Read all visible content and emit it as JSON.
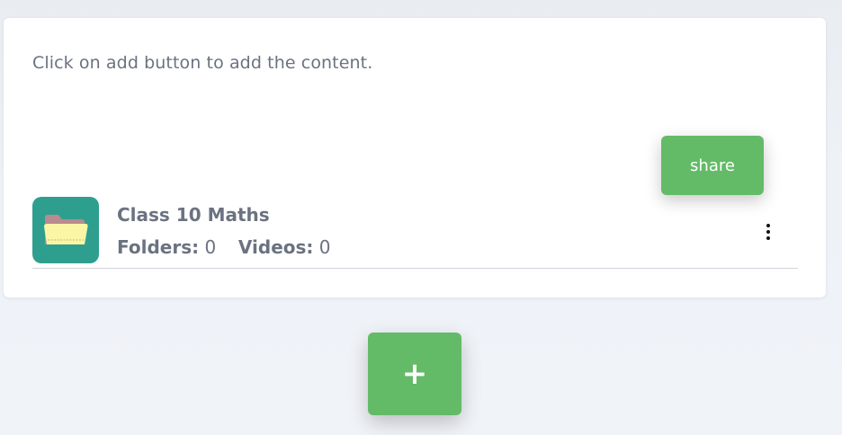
{
  "content": {
    "hint_text": "Click on add button to add the content."
  },
  "toolbar": {
    "share_label": "share",
    "add_label": "+"
  },
  "items": [
    {
      "title": "Class 10 Maths",
      "folders_label": "Folders:",
      "folders_count": "0",
      "videos_label": "Videos:",
      "videos_count": "0",
      "icon": "folder-icon",
      "menu_icon": "more-vertical-icon"
    }
  ],
  "colors": {
    "accent": "#63bb67",
    "folder_tile": "#2e9f8f",
    "text_muted": "#6b7280",
    "background": "#eef2f6"
  }
}
